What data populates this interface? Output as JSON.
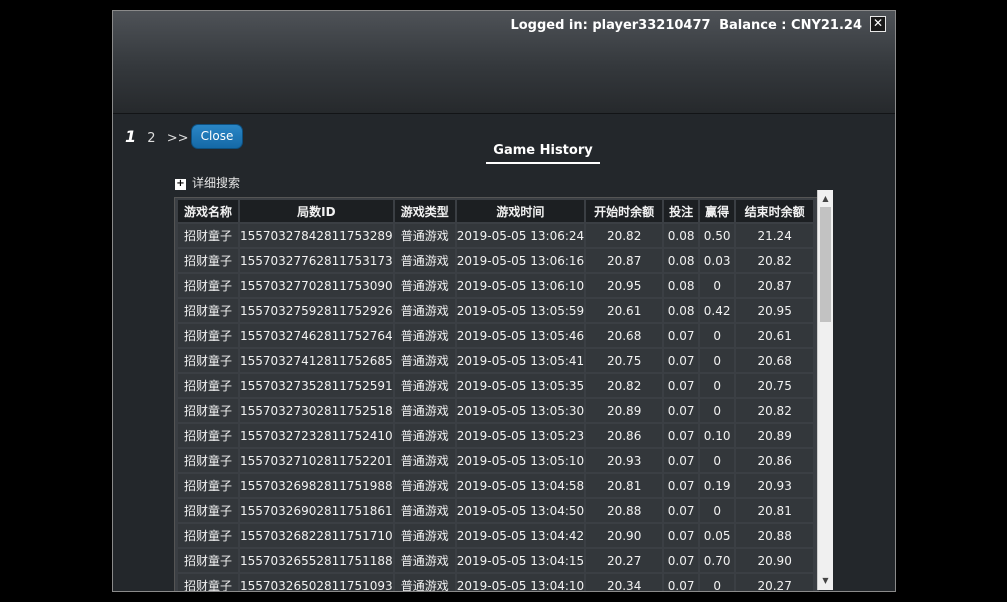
{
  "header": {
    "logged_in": "Logged in: player33210477",
    "balance": "Balance : CNY21.24",
    "close_glyph": "✕"
  },
  "pager": {
    "pages": [
      "1",
      "2"
    ],
    "current": "1",
    "next": ">>"
  },
  "close_button": "Close",
  "title": "Game History",
  "advanced_search": {
    "toggle": "+",
    "label": "详细搜索"
  },
  "table": {
    "columns": [
      "游戏名称",
      "局数ID",
      "游戏类型",
      "游戏时间",
      "开始时余额",
      "投注",
      "赢得",
      "结束时余额"
    ],
    "rows": [
      [
        "招财童子",
        "15570327842811753289",
        "普通游戏",
        "2019-05-05 13:06:24",
        "20.82",
        "0.08",
        "0.50",
        "21.24"
      ],
      [
        "招财童子",
        "15570327762811753173",
        "普通游戏",
        "2019-05-05 13:06:16",
        "20.87",
        "0.08",
        "0.03",
        "20.82"
      ],
      [
        "招财童子",
        "15570327702811753090",
        "普通游戏",
        "2019-05-05 13:06:10",
        "20.95",
        "0.08",
        "0",
        "20.87"
      ],
      [
        "招财童子",
        "15570327592811752926",
        "普通游戏",
        "2019-05-05 13:05:59",
        "20.61",
        "0.08",
        "0.42",
        "20.95"
      ],
      [
        "招财童子",
        "15570327462811752764",
        "普通游戏",
        "2019-05-05 13:05:46",
        "20.68",
        "0.07",
        "0",
        "20.61"
      ],
      [
        "招财童子",
        "15570327412811752685",
        "普通游戏",
        "2019-05-05 13:05:41",
        "20.75",
        "0.07",
        "0",
        "20.68"
      ],
      [
        "招财童子",
        "15570327352811752591",
        "普通游戏",
        "2019-05-05 13:05:35",
        "20.82",
        "0.07",
        "0",
        "20.75"
      ],
      [
        "招财童子",
        "15570327302811752518",
        "普通游戏",
        "2019-05-05 13:05:30",
        "20.89",
        "0.07",
        "0",
        "20.82"
      ],
      [
        "招财童子",
        "15570327232811752410",
        "普通游戏",
        "2019-05-05 13:05:23",
        "20.86",
        "0.07",
        "0.10",
        "20.89"
      ],
      [
        "招财童子",
        "15570327102811752201",
        "普通游戏",
        "2019-05-05 13:05:10",
        "20.93",
        "0.07",
        "0",
        "20.86"
      ],
      [
        "招财童子",
        "15570326982811751988",
        "普通游戏",
        "2019-05-05 13:04:58",
        "20.81",
        "0.07",
        "0.19",
        "20.93"
      ],
      [
        "招财童子",
        "15570326902811751861",
        "普通游戏",
        "2019-05-05 13:04:50",
        "20.88",
        "0.07",
        "0",
        "20.81"
      ],
      [
        "招财童子",
        "15570326822811751710",
        "普通游戏",
        "2019-05-05 13:04:42",
        "20.90",
        "0.07",
        "0.05",
        "20.88"
      ],
      [
        "招财童子",
        "15570326552811751188",
        "普通游戏",
        "2019-05-05 13:04:15",
        "20.27",
        "0.07",
        "0.70",
        "20.90"
      ],
      [
        "招财童子",
        "15570326502811751093",
        "普通游戏",
        "2019-05-05 13:04:10",
        "20.34",
        "0.07",
        "0",
        "20.27"
      ]
    ]
  },
  "scrollbar": {
    "up_glyph": "▲",
    "down_glyph": "▼"
  }
}
